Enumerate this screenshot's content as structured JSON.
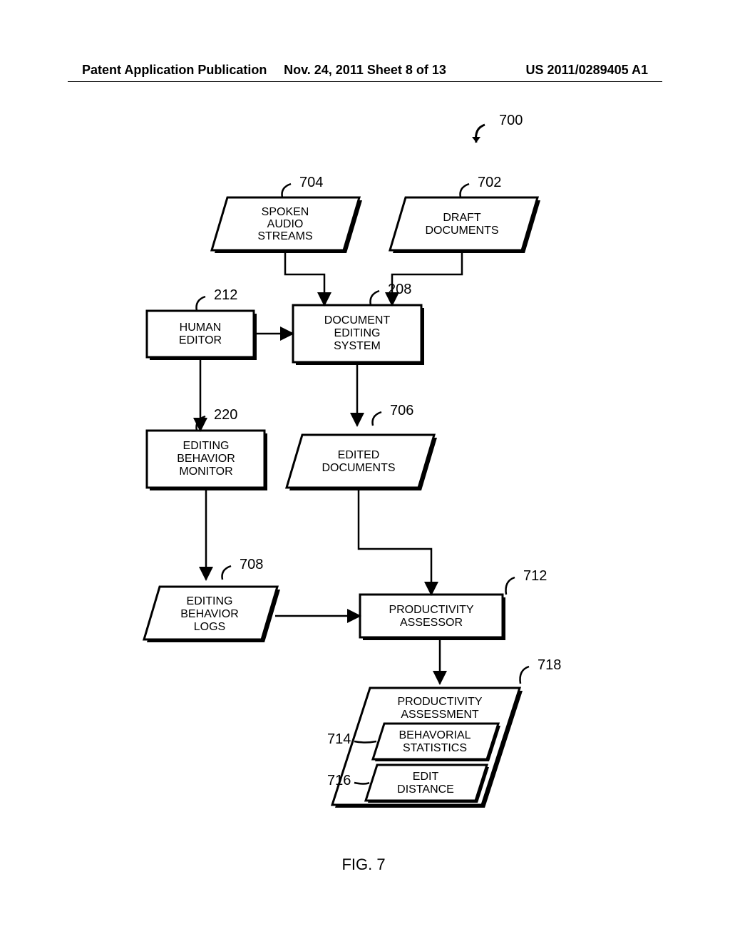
{
  "header": {
    "left": "Patent Application Publication",
    "center": "Nov. 24, 2011  Sheet 8 of 13",
    "right": "US 2011/0289405 A1"
  },
  "figure_label": "FIG. 7",
  "nodes": {
    "n700": {
      "label": "700"
    },
    "n704": {
      "label": "704",
      "text": [
        "SPOKEN",
        "AUDIO",
        "STREAMS"
      ]
    },
    "n702": {
      "label": "702",
      "text": [
        "DRAFT",
        "DOCUMENTS"
      ]
    },
    "n212": {
      "label": "212",
      "text": [
        "HUMAN",
        "EDITOR"
      ]
    },
    "n208": {
      "label": "208",
      "text": [
        "DOCUMENT",
        "EDITING",
        "SYSTEM"
      ]
    },
    "n220": {
      "label": "220",
      "text": [
        "EDITING",
        "BEHAVIOR",
        "MONITOR"
      ]
    },
    "n706": {
      "label": "706",
      "text": [
        "EDITED",
        "DOCUMENTS"
      ]
    },
    "n708": {
      "label": "708",
      "text": [
        "EDITING",
        "BEHAVIOR",
        "LOGS"
      ]
    },
    "n712": {
      "label": "712",
      "text": [
        "PRODUCTIVITY",
        "ASSESSOR"
      ]
    },
    "n718": {
      "label": "718",
      "text": [
        "PRODUCTIVITY",
        "ASSESSMENT"
      ]
    },
    "n714": {
      "label": "714",
      "text": [
        "BEHAVORIAL",
        "STATISTICS"
      ]
    },
    "n716": {
      "label": "716",
      "text": [
        "EDIT",
        "DISTANCE"
      ]
    }
  }
}
